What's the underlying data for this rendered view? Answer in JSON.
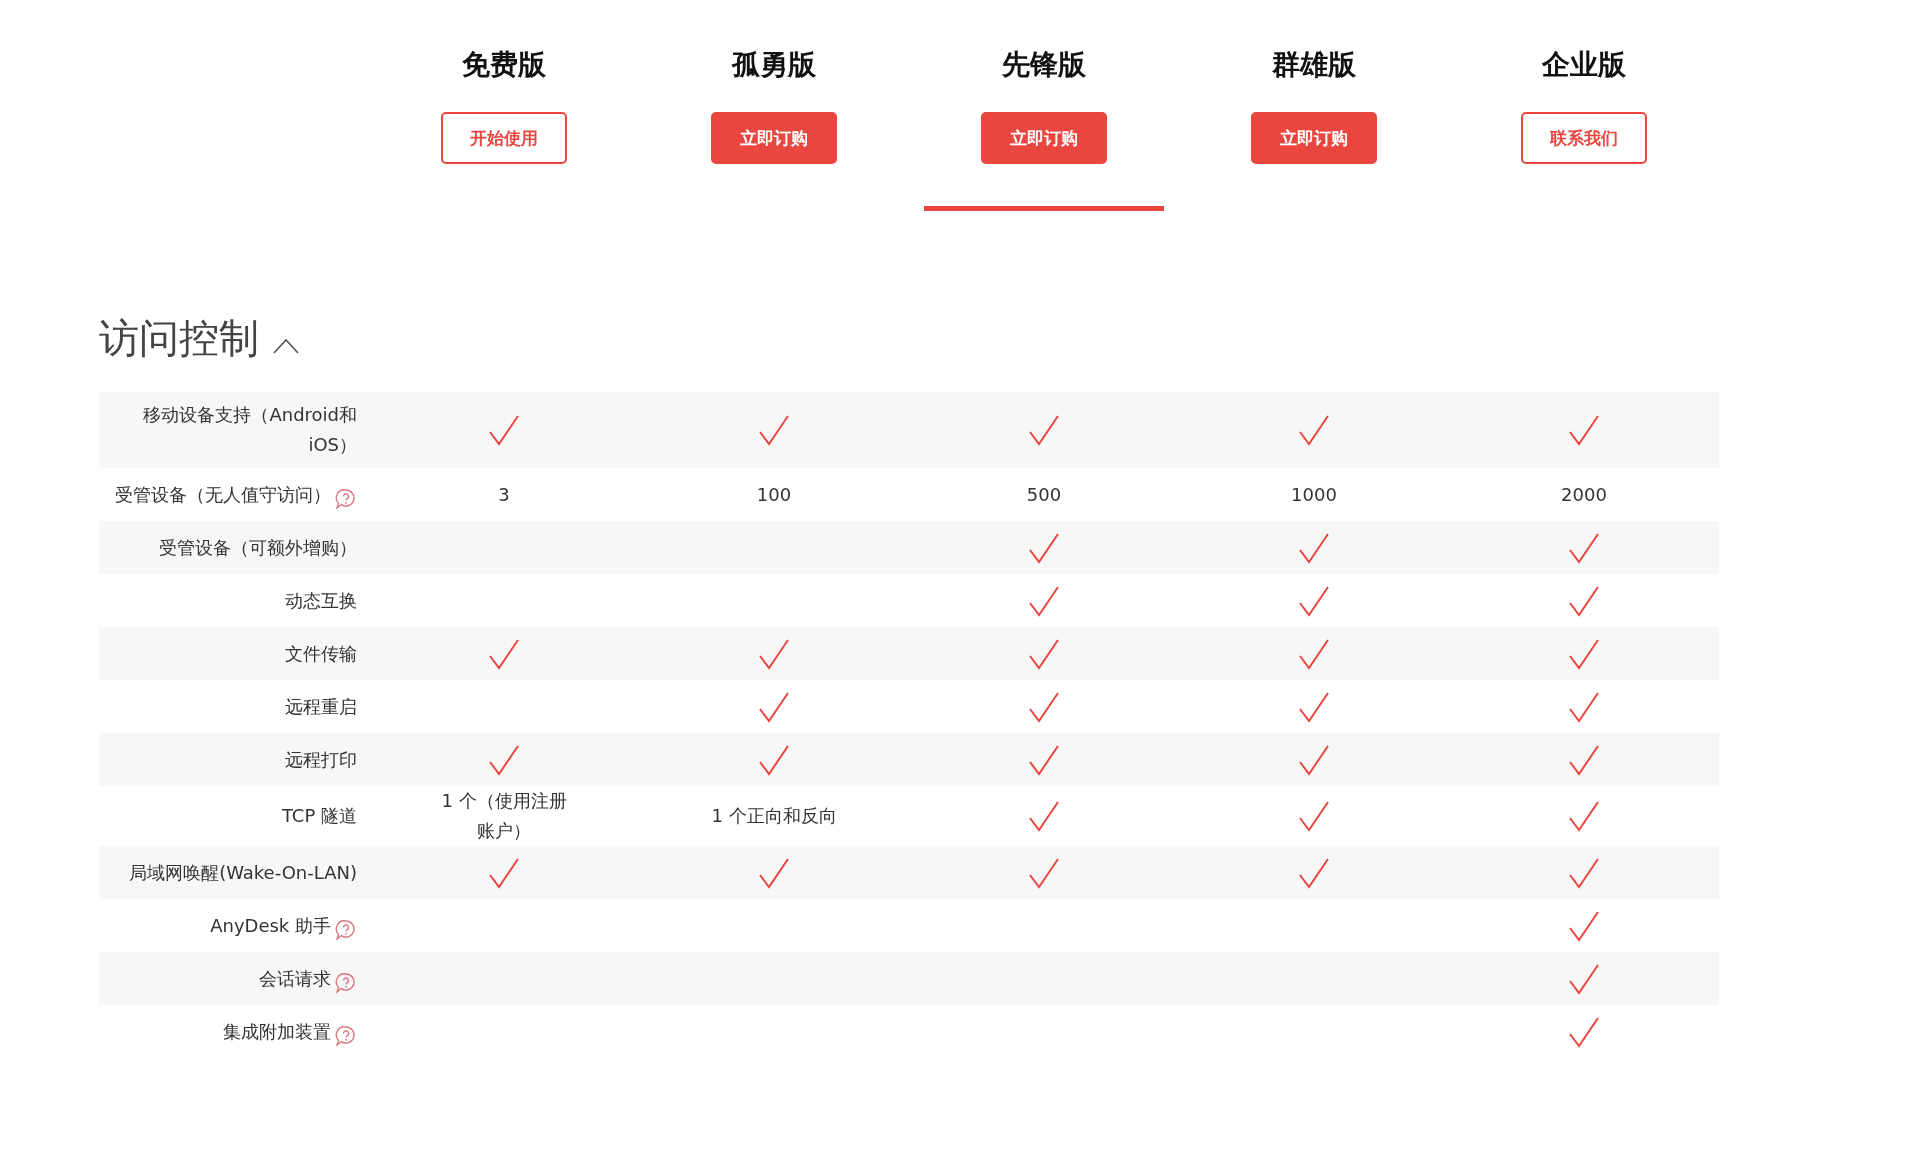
{
  "plans": [
    {
      "name": "免费版",
      "button": {
        "label": "开始使用",
        "kind": "outline"
      },
      "selected": false
    },
    {
      "name": "孤勇版",
      "button": {
        "label": "立即订购",
        "kind": "filled"
      },
      "selected": false
    },
    {
      "name": "先锋版",
      "button": {
        "label": "立即订购",
        "kind": "filled"
      },
      "selected": true
    },
    {
      "name": "群雄版",
      "button": {
        "label": "立即订购",
        "kind": "filled"
      },
      "selected": false
    },
    {
      "name": "企业版",
      "button": {
        "label": "联系我们",
        "kind": "outline"
      },
      "selected": false
    }
  ],
  "section": {
    "title": "访问控制",
    "expanded": true,
    "rows": [
      {
        "label": "移动设备支持（Android和iOS）",
        "help": false,
        "cells": [
          {
            "kind": "check"
          },
          {
            "kind": "check"
          },
          {
            "kind": "check"
          },
          {
            "kind": "check"
          },
          {
            "kind": "check"
          }
        ]
      },
      {
        "label": "受管设备（无人值守访问）",
        "help": true,
        "cells": [
          {
            "kind": "text",
            "text": "3"
          },
          {
            "kind": "text",
            "text": "100"
          },
          {
            "kind": "text",
            "text": "500"
          },
          {
            "kind": "text",
            "text": "1000"
          },
          {
            "kind": "text",
            "text": "2000"
          }
        ]
      },
      {
        "label": "受管设备（可额外增购）",
        "help": false,
        "cells": [
          {
            "kind": "none"
          },
          {
            "kind": "none"
          },
          {
            "kind": "check"
          },
          {
            "kind": "check"
          },
          {
            "kind": "check"
          }
        ]
      },
      {
        "label": "动态互换",
        "help": false,
        "cells": [
          {
            "kind": "none"
          },
          {
            "kind": "none"
          },
          {
            "kind": "check"
          },
          {
            "kind": "check"
          },
          {
            "kind": "check"
          }
        ]
      },
      {
        "label": "文件传输",
        "help": false,
        "cells": [
          {
            "kind": "check"
          },
          {
            "kind": "check"
          },
          {
            "kind": "check"
          },
          {
            "kind": "check"
          },
          {
            "kind": "check"
          }
        ]
      },
      {
        "label": "远程重启",
        "help": false,
        "cells": [
          {
            "kind": "none"
          },
          {
            "kind": "check"
          },
          {
            "kind": "check"
          },
          {
            "kind": "check"
          },
          {
            "kind": "check"
          }
        ]
      },
      {
        "label": "远程打印",
        "help": false,
        "cells": [
          {
            "kind": "check"
          },
          {
            "kind": "check"
          },
          {
            "kind": "check"
          },
          {
            "kind": "check"
          },
          {
            "kind": "check"
          }
        ]
      },
      {
        "label": "TCP 隧道",
        "help": false,
        "cells": [
          {
            "kind": "text",
            "text": "1 个（使用注册账户）"
          },
          {
            "kind": "text",
            "text": "1 个正向和反向"
          },
          {
            "kind": "check"
          },
          {
            "kind": "check"
          },
          {
            "kind": "check"
          }
        ]
      },
      {
        "label": "局域网唤醒(Wake-On-LAN)",
        "help": false,
        "cells": [
          {
            "kind": "check"
          },
          {
            "kind": "check"
          },
          {
            "kind": "check"
          },
          {
            "kind": "check"
          },
          {
            "kind": "check"
          }
        ]
      },
      {
        "label": "AnyDesk 助手",
        "help": true,
        "cells": [
          {
            "kind": "none"
          },
          {
            "kind": "none"
          },
          {
            "kind": "none"
          },
          {
            "kind": "none"
          },
          {
            "kind": "check"
          }
        ]
      },
      {
        "label": "会话请求",
        "help": true,
        "cells": [
          {
            "kind": "none"
          },
          {
            "kind": "none"
          },
          {
            "kind": "none"
          },
          {
            "kind": "none"
          },
          {
            "kind": "check"
          }
        ]
      },
      {
        "label": "集成附加装置",
        "help": true,
        "cells": [
          {
            "kind": "none"
          },
          {
            "kind": "none"
          },
          {
            "kind": "none"
          },
          {
            "kind": "none"
          },
          {
            "kind": "check"
          }
        ]
      }
    ]
  }
}
